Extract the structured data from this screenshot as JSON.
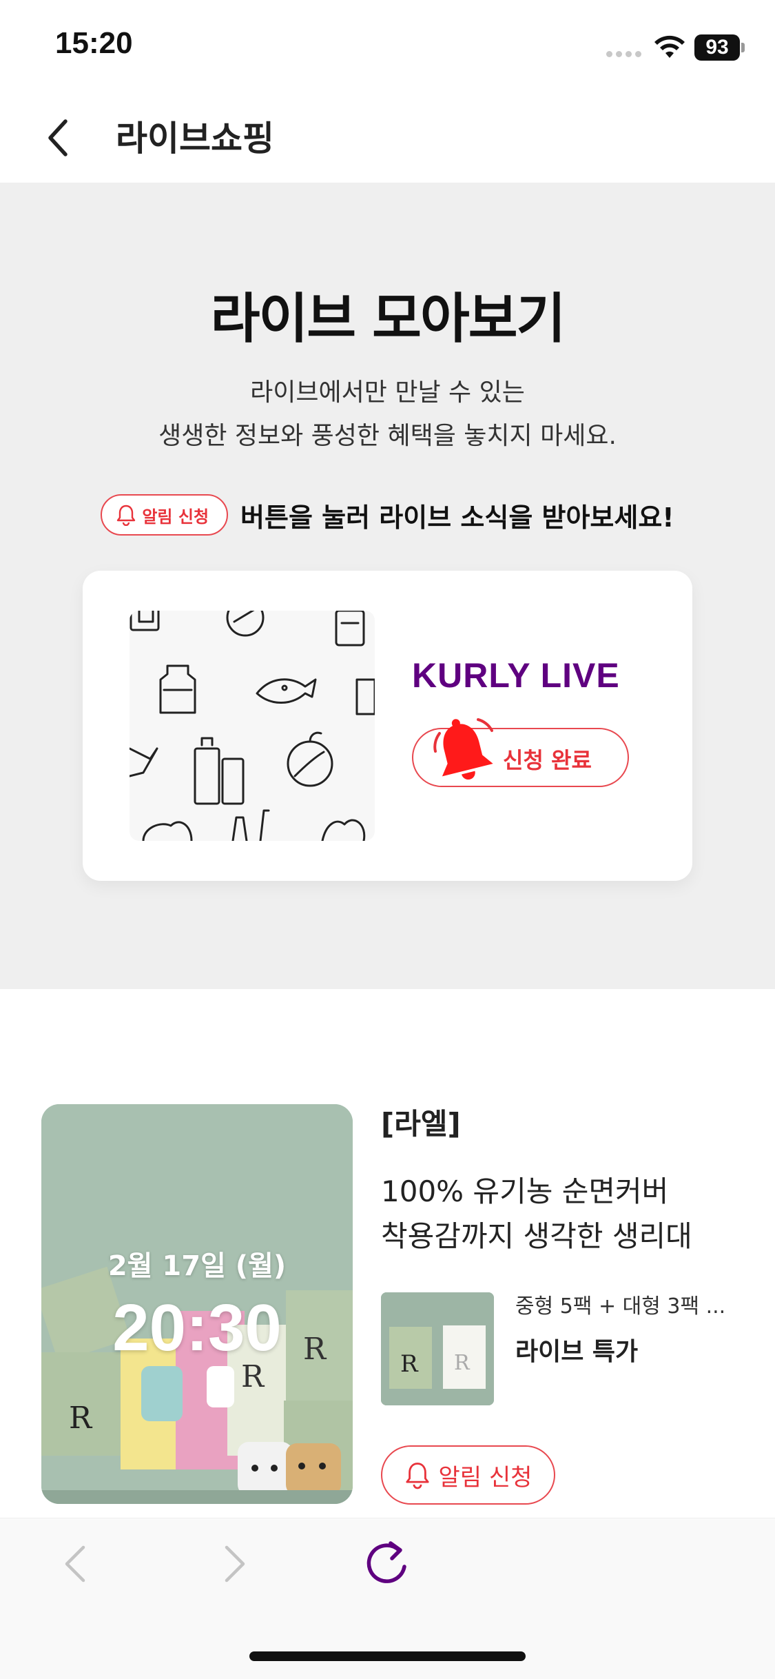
{
  "status": {
    "time": "15:20",
    "battery": "93"
  },
  "header": {
    "title": "라이브쇼핑",
    "back_icon": "chevron-left-icon"
  },
  "hero": {
    "title": "라이브 모아보기",
    "subtitle_line1": "라이브에서만 만날 수 있는",
    "subtitle_line2": "생생한 정보와 풍성한 혜택을 놓치지 마세요.",
    "notify_pill_label": "알림 신청",
    "hint_text": "버튼을 눌러 라이브 소식을 받아보세요!",
    "card": {
      "logo_text": "KURLY LIVE",
      "applied_label": "신청 완료"
    }
  },
  "product": {
    "date": "2월 17일 (월)",
    "time": "20:30",
    "brand": "[라엘]",
    "desc_line1": "100% 유기농 순면커버",
    "desc_line2": "착용감까지 생각한 생리대",
    "offer_name": "중형 5팩 + 대형 3팩 ...",
    "offer_tag": "라이브 특가",
    "notify_label": "알림 신청"
  },
  "colors": {
    "accent_red": "#e8323a",
    "kurly_purple": "#5f0080",
    "hero_bg": "#efefef"
  }
}
